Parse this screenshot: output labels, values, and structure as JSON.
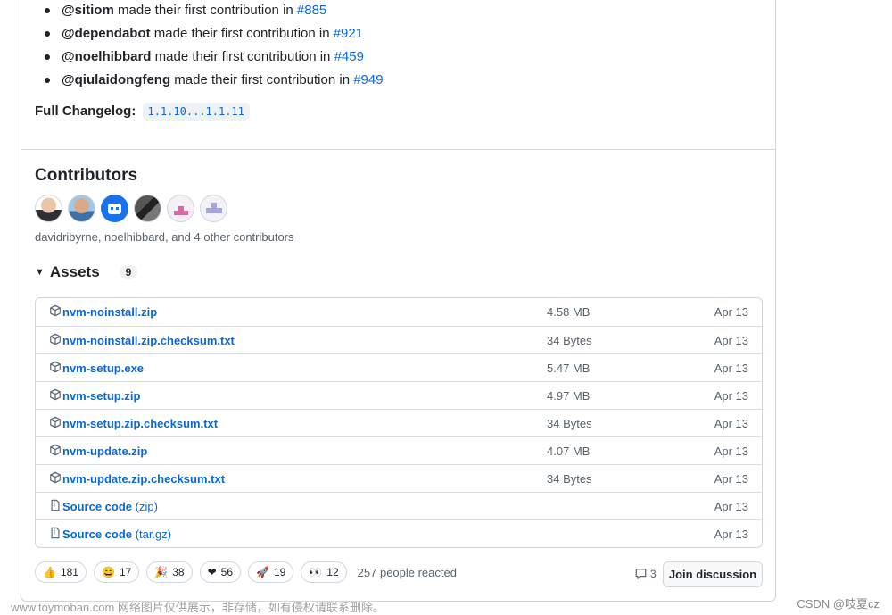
{
  "new_contributors": [
    {
      "user": "@sitiom",
      "text": " made their first contribution in ",
      "pr": "#885"
    },
    {
      "user": "@dependabot",
      "text": " made their first contribution in ",
      "pr": "#921"
    },
    {
      "user": "@noelhibbard",
      "text": " made their first contribution in ",
      "pr": "#459"
    },
    {
      "user": "@qiulaidongfeng",
      "text": " made their first contribution in ",
      "pr": "#949"
    }
  ],
  "changelog": {
    "label": "Full Changelog:",
    "range": "1.1.10...1.1.11"
  },
  "contributors": {
    "title": "Contributors",
    "summary": "davidribyrne, noelhibbard, and 4 other contributors"
  },
  "assets": {
    "title": "Assets",
    "count": "9",
    "items": [
      {
        "name": "nvm-noinstall.zip",
        "ext": "",
        "size": "4.58 MB",
        "date": "Apr 13",
        "icon": "package-icon"
      },
      {
        "name": "nvm-noinstall.zip.checksum.txt",
        "ext": "",
        "size": "34 Bytes",
        "date": "Apr 13",
        "icon": "package-icon"
      },
      {
        "name": "nvm-setup.exe",
        "ext": "",
        "size": "5.47 MB",
        "date": "Apr 13",
        "icon": "package-icon"
      },
      {
        "name": "nvm-setup.zip",
        "ext": "",
        "size": "4.97 MB",
        "date": "Apr 13",
        "icon": "package-icon"
      },
      {
        "name": "nvm-setup.zip.checksum.txt",
        "ext": "",
        "size": "34 Bytes",
        "date": "Apr 13",
        "icon": "package-icon"
      },
      {
        "name": "nvm-update.zip",
        "ext": "",
        "size": "4.07 MB",
        "date": "Apr 13",
        "icon": "package-icon"
      },
      {
        "name": "nvm-update.zip.checksum.txt",
        "ext": "",
        "size": "34 Bytes",
        "date": "Apr 13",
        "icon": "package-icon"
      },
      {
        "name": "Source code",
        "ext": " (zip)",
        "size": "",
        "date": "Apr 13",
        "icon": "file-zip-icon"
      },
      {
        "name": "Source code",
        "ext": " (tar.gz)",
        "size": "",
        "date": "Apr 13",
        "icon": "file-zip-icon"
      }
    ]
  },
  "reactions": {
    "items": [
      {
        "icon": "thumbs-up-icon",
        "emoji": "👍",
        "count": "181"
      },
      {
        "icon": "laugh-icon",
        "emoji": "😄",
        "count": "17"
      },
      {
        "icon": "tada-icon",
        "emoji": "🎉",
        "count": "38"
      },
      {
        "icon": "heart-icon",
        "emoji": "❤",
        "count": "56"
      },
      {
        "icon": "rocket-icon",
        "emoji": "🚀",
        "count": "19"
      },
      {
        "icon": "eyes-icon",
        "emoji": "👀",
        "count": "12"
      }
    ],
    "summary": "257 people reacted"
  },
  "discussion": {
    "comment_count": "3",
    "join_label": "Join discussion"
  },
  "watermark": "www.toymoban.com 网络图片仅供展示，非存储，如有侵权请联系删除。",
  "csdn_credit": "CSDN @吱夏cz",
  "colors": {
    "link": "#0969da",
    "border": "#d0d7de",
    "muted": "#59636e"
  }
}
